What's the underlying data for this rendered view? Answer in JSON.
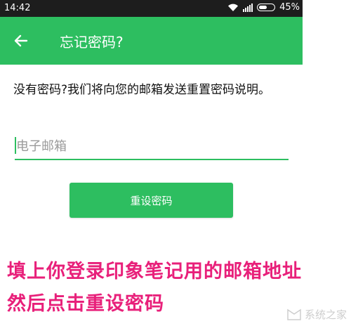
{
  "status_bar": {
    "time": "14:42",
    "battery": "45%"
  },
  "app_bar": {
    "title": "忘记密码?"
  },
  "form": {
    "description": "没有密码?我们将向您的邮箱发送重置密码说明。",
    "email_placeholder": "电子邮箱",
    "reset_button": "重设密码"
  },
  "annotation": {
    "line1": "填上你登录印象笔记用的邮箱地址",
    "line2": "然后点击重设密码"
  },
  "watermark": {
    "text": "系统之家"
  },
  "colors": {
    "accent": "#2dbe60",
    "caption": "#e8207a"
  }
}
